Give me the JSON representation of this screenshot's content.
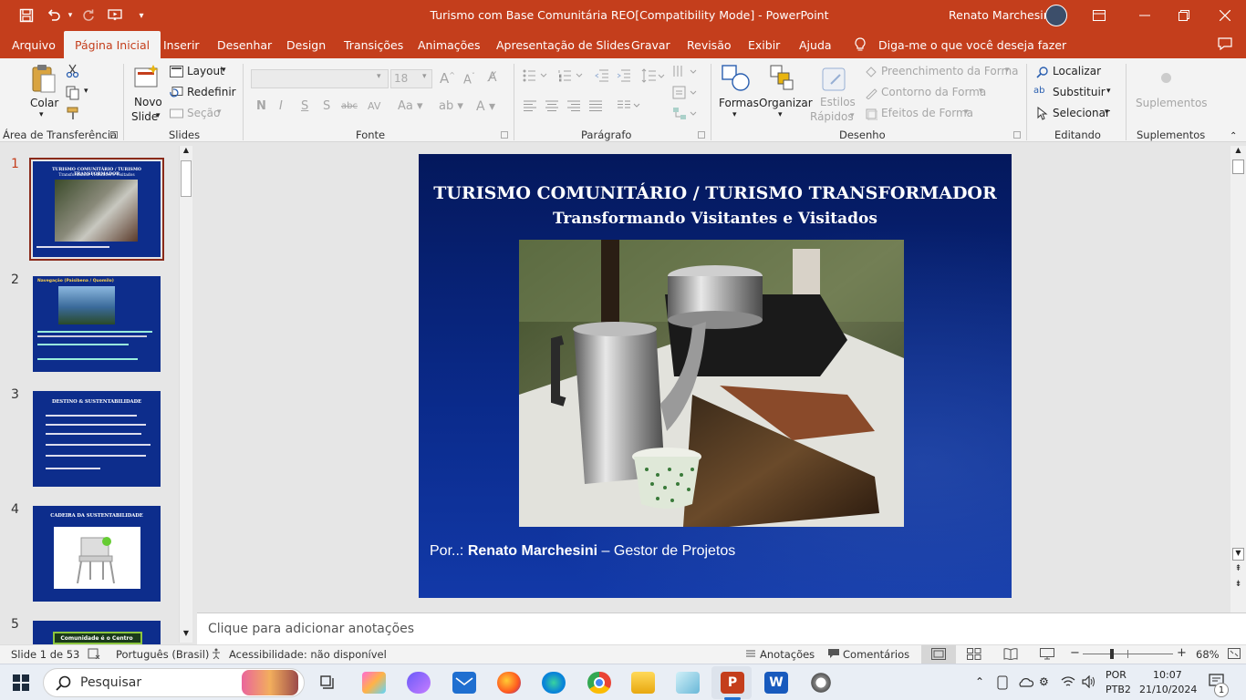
{
  "window": {
    "title": "Turismo com Base Comunitária REO[Compatibility Mode]  -  PowerPoint",
    "user": "Renato Marchesini"
  },
  "menu": {
    "tabs": [
      "Arquivo",
      "Página Inicial",
      "Inserir",
      "Desenhar",
      "Design",
      "Transições",
      "Animações",
      "Apresentação de Slides",
      "Gravar",
      "Revisão",
      "Exibir",
      "Ajuda"
    ],
    "active_tab": "Página Inicial",
    "tell_me": "Diga-me o que você deseja fazer"
  },
  "ribbon": {
    "clipboard": {
      "paste": "Colar",
      "group": "Área de Transferência"
    },
    "slides": {
      "new_slide_1": "Novo",
      "new_slide_2": "Slide",
      "layout": "Layout",
      "reset": "Redefinir",
      "section": "Seção",
      "group": "Slides"
    },
    "font": {
      "name": "",
      "size": "18",
      "group": "Fonte"
    },
    "paragraph": {
      "group": "Parágrafo"
    },
    "drawing": {
      "shapes": "Formas",
      "arrange": "Organizar",
      "quick_styles_1": "Estilos",
      "quick_styles_2": "Rápidos",
      "fill": "Preenchimento da Forma",
      "outline": "Contorno da Forma",
      "effects": "Efeitos de Forma",
      "group": "Desenho"
    },
    "editing": {
      "find": "Localizar",
      "replace": "Substituir",
      "select": "Selecionar",
      "group": "Editando"
    },
    "addins": {
      "button": "Suplementos",
      "group": "Suplementos"
    }
  },
  "slides_panel": {
    "numbers": [
      "1",
      "2",
      "3",
      "4",
      "5"
    ],
    "thumb1": {
      "title": "TURISMO COMUNITÁRIO / TURISMO TRANSFORMADOR",
      "subtitle": "Transformando Visitantes e Visitados"
    },
    "thumb2": {
      "title": "Navegação (Paisibena / Quomilo)"
    },
    "thumb3": {
      "title": "DESTINO & SUSTENTABILIDADE"
    },
    "thumb4": {
      "title": "CADEIRA DA SUSTENTABILIDADE"
    },
    "thumb5": {
      "title": "Comunidade é o Centro"
    }
  },
  "slide": {
    "title": "TURISMO COMUNITÁRIO / TURISMO TRANSFORMADOR",
    "subtitle": "Transformando Visitantes e Visitados",
    "footer_prefix": "Por..:",
    "footer_name": "Renato Marchesini",
    "footer_suffix": "– Gestor de Projetos"
  },
  "notes": {
    "placeholder": "Clique para adicionar anotações"
  },
  "status": {
    "slide_count": "Slide 1 de 53",
    "language": "Português (Brasil)",
    "accessibility": "Acessibilidade: não disponível",
    "notes": "Anotações",
    "comments": "Comentários",
    "zoom": "68%"
  },
  "taskbar": {
    "search": "Pesquisar",
    "lang_1": "POR",
    "lang_2": "PTB2",
    "time": "10:07",
    "date": "21/10/2024",
    "notif_count": "1"
  },
  "colors": {
    "accent": "#c43e1c",
    "slide_bg": "#0a2a8a"
  }
}
